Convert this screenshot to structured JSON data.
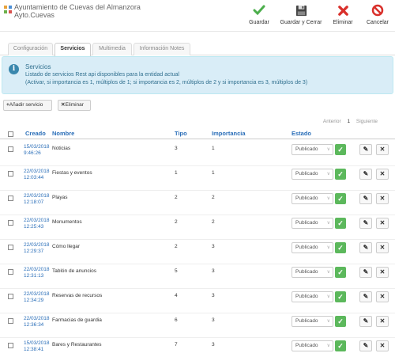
{
  "app": {
    "title_line1": "Ayuntamiento de Cuevas del Almanzora",
    "title_line2": "Ayto.Cuevas"
  },
  "toolbar": {
    "guardar": "Guardar",
    "guardar_cerrar": "Guardar y Cerrar",
    "eliminar": "Eliminar",
    "cancelar": "Cancelar"
  },
  "colors": {
    "accent": "#2a6eb8",
    "info_bg": "#d9edf7",
    "ok_green": "#5cb85c",
    "delete_red": "#d9302b"
  },
  "tabs": [
    {
      "label": "Configuración"
    },
    {
      "label": "Servicios"
    },
    {
      "label": "Multimedia"
    },
    {
      "label": "Información Notes"
    }
  ],
  "info": {
    "title": "Servicios",
    "line1": "Listado de servicios Rest api disponibles para la entidad actual",
    "line2": "(Activar, si importancia es 1, múltiplos de 1; si importancia es 2, múltiplos de 2 y si importancia es 3, múltiplos de 3)"
  },
  "actions": {
    "add": "Añadir servicio",
    "delete": "Eliminar"
  },
  "pager": {
    "prev": "Anterior",
    "page": "1",
    "next": "Siguiente"
  },
  "table": {
    "headers": {
      "creado": "Creado",
      "nombre": "Nombre",
      "tipo": "Tipo",
      "importancia": "Importancia",
      "estado": "Estado"
    },
    "rows": [
      {
        "date": "15/03/2018",
        "time": "9:46:26",
        "nombre": "Noticias",
        "tipo": "3",
        "importancia": "1",
        "estado": "Publicado"
      },
      {
        "date": "22/03/2018",
        "time": "12:03:44",
        "nombre": "Fiestas y eventos",
        "tipo": "1",
        "importancia": "1",
        "estado": "Publicado"
      },
      {
        "date": "22/03/2018",
        "time": "12:18:07",
        "nombre": "Playas",
        "tipo": "2",
        "importancia": "2",
        "estado": "Publicado"
      },
      {
        "date": "22/03/2018",
        "time": "12:25:43",
        "nombre": "Monumentos",
        "tipo": "2",
        "importancia": "2",
        "estado": "Publicado"
      },
      {
        "date": "22/03/2018",
        "time": "12:29:37",
        "nombre": "Cómo llegar",
        "tipo": "2",
        "importancia": "3",
        "estado": "Publicado"
      },
      {
        "date": "22/03/2018",
        "time": "12:31:13",
        "nombre": "Tablón de anuncios",
        "tipo": "5",
        "importancia": "3",
        "estado": "Publicado"
      },
      {
        "date": "22/03/2018",
        "time": "12:34:29",
        "nombre": "Reservas de recursos",
        "tipo": "4",
        "importancia": "3",
        "estado": "Publicado"
      },
      {
        "date": "22/03/2018",
        "time": "12:36:34",
        "nombre": "Farmacias de guardia",
        "tipo": "6",
        "importancia": "3",
        "estado": "Publicado"
      },
      {
        "date": "15/03/2018",
        "time": "12:38:41",
        "nombre": "Bares y Restaurantes",
        "tipo": "7",
        "importancia": "3",
        "estado": "Publicado"
      }
    ]
  }
}
